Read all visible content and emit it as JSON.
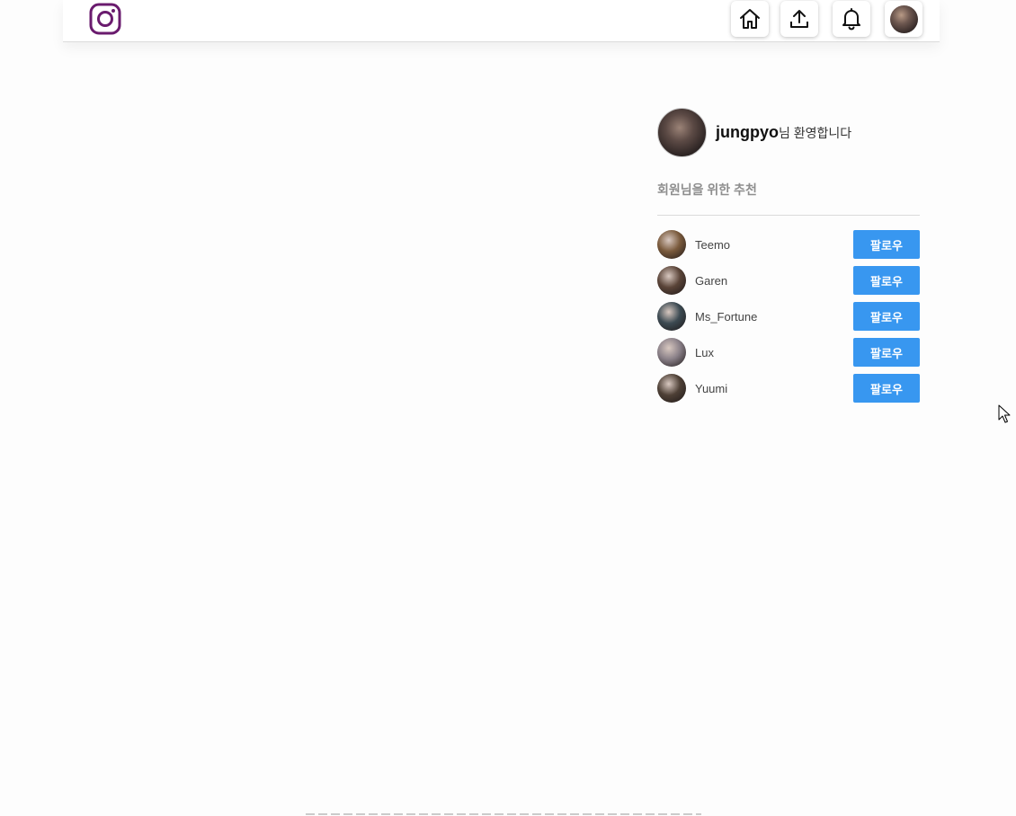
{
  "header": {
    "logo_icon": "instagram-icon",
    "nav": [
      {
        "name": "home",
        "icon": "home-icon"
      },
      {
        "name": "upload",
        "icon": "upload-icon"
      },
      {
        "name": "notifications",
        "icon": "bell-icon"
      },
      {
        "name": "profile",
        "icon": "avatar"
      }
    ]
  },
  "sidebar": {
    "username": "jungpyo",
    "welcome_suffix": "님 환영합니다",
    "recommend_title": "회원님을 위한 추천",
    "follow_label": "팔로우",
    "recommendations": [
      {
        "name": "Teemo",
        "color": "#7a5a3c"
      },
      {
        "name": "Garen",
        "color": "#5a4438"
      },
      {
        "name": "Ms_Fortune",
        "color": "#3c4a52"
      },
      {
        "name": "Lux",
        "color": "#8a8088"
      },
      {
        "name": "Yuumi",
        "color": "#4e4036"
      }
    ]
  },
  "colors": {
    "accent": "#3897f0",
    "logo": "#6a1b6e"
  }
}
